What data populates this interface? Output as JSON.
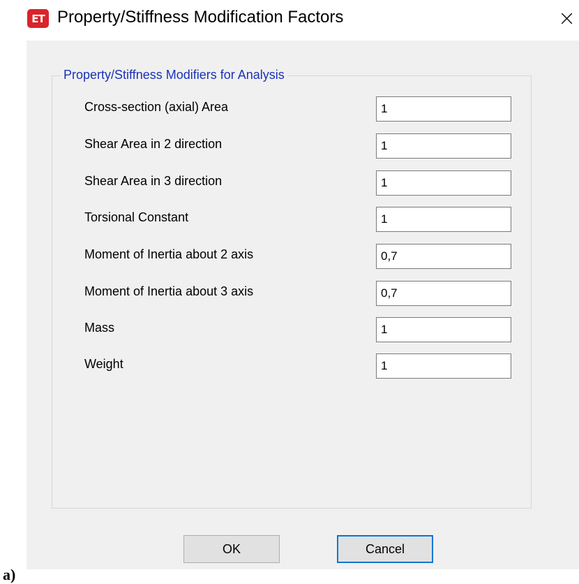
{
  "window": {
    "icon_text": "ET",
    "title": "Property/Stiffness Modification Factors",
    "close_symbol": "×"
  },
  "group": {
    "title": "Property/Stiffness Modifiers for Analysis",
    "rows": [
      {
        "label": "Cross-section (axial) Area",
        "value": "1"
      },
      {
        "label": "Shear Area in 2 direction",
        "value": "1"
      },
      {
        "label": "Shear Area in 3 direction",
        "value": "1"
      },
      {
        "label": "Torsional Constant",
        "value": "1"
      },
      {
        "label": "Moment of Inertia about 2 axis",
        "value": "0,7"
      },
      {
        "label": "Moment of Inertia about 3 axis",
        "value": "0,7"
      },
      {
        "label": "Mass",
        "value": "1"
      },
      {
        "label": "Weight",
        "value": "1"
      }
    ]
  },
  "buttons": {
    "ok_label": "OK",
    "cancel_label": "Cancel"
  },
  "caption": "a)",
  "colors": {
    "group_title": "#1a33b8",
    "icon_background": "#d9242b",
    "dialog_background": "#f0f0f0",
    "default_button_border": "#0078d7"
  }
}
